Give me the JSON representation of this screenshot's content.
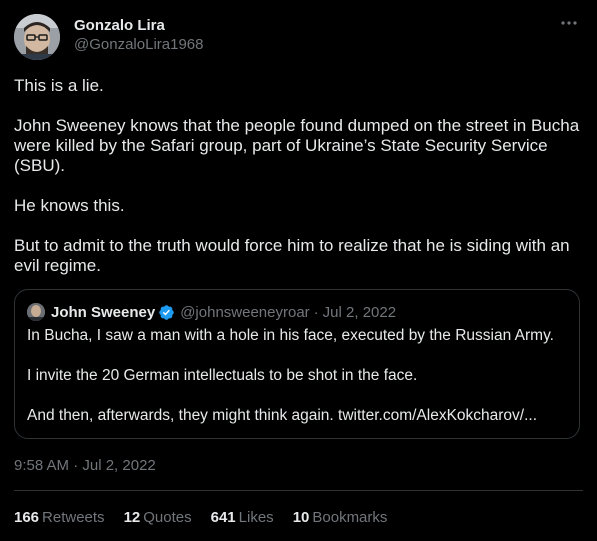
{
  "author": {
    "display_name": "Gonzalo Lira",
    "handle": "@GonzaloLira1968"
  },
  "more_icon": "more-horizontal-icon",
  "tweet": {
    "paragraphs": [
      "This is a lie.",
      "John Sweeney knows that the people found dumped on the street in Bucha were killed by the Safari group, part of Ukraine’s State Security Service (SBU).",
      "He knows this.",
      "But to admit to the truth would force him to realize that he is siding with an evil regime."
    ]
  },
  "quote": {
    "display_name": "John Sweeney",
    "handle": "@johnsweeneyroar",
    "separator": "·",
    "date": "Jul 2, 2022",
    "verified_icon": "verified-badge-icon",
    "paragraphs": [
      "In Bucha, I saw a man with a hole in his face, executed by the Russian Army.",
      "I invite the 20 German intellectuals to be shot in the face.",
      "And then, afterwards, they might  think again. twitter.com/AlexKokcharov/..."
    ]
  },
  "timestamp": "9:58 AM · Jul 2, 2022",
  "stats": [
    {
      "count": "166",
      "label": "Retweets"
    },
    {
      "count": "12",
      "label": "Quotes"
    },
    {
      "count": "641",
      "label": "Likes"
    },
    {
      "count": "10",
      "label": "Bookmarks"
    }
  ],
  "colors": {
    "background": "#000000",
    "text": "#e7e9ea",
    "muted": "#71767b",
    "border": "#2f3336",
    "verified": "#1d9bf0"
  }
}
